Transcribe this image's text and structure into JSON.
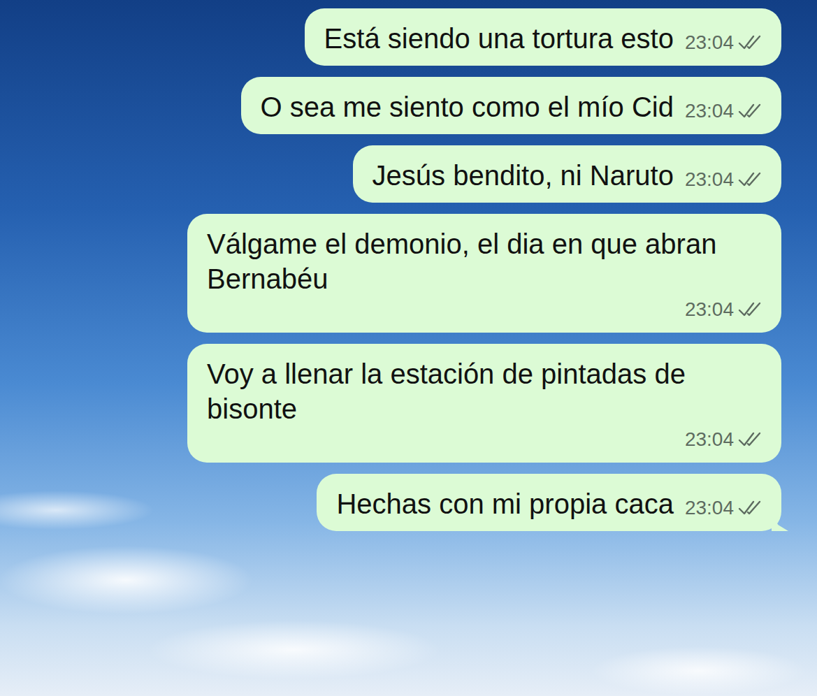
{
  "chat": {
    "messages": [
      {
        "text": "Está siendo una tortura esto",
        "time": "23:04",
        "outgoing": true,
        "read": false
      },
      {
        "text": "O sea me siento como el mío Cid",
        "time": "23:04",
        "outgoing": true,
        "read": false
      },
      {
        "text": "Jesús bendito, ni Naruto",
        "time": "23:04",
        "outgoing": true,
        "read": false
      },
      {
        "text": "Válgame el demonio, el dia en que abran Bernabéu",
        "time": "23:04",
        "outgoing": true,
        "read": false
      },
      {
        "text": "Voy a llenar la estación de pintadas de bisonte",
        "time": "23:04",
        "outgoing": true,
        "read": false
      },
      {
        "text": "Hechas con mi propia caca",
        "time": "23:04",
        "outgoing": true,
        "read": false
      }
    ]
  }
}
